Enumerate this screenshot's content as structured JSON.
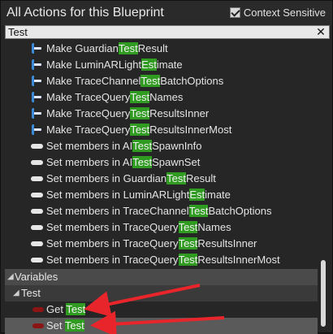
{
  "header": {
    "title": "All Actions for this Blueprint",
    "context_sensitive_label": "Context Sensitive",
    "context_sensitive_checked": true
  },
  "search": {
    "value": "Test",
    "clear_icon": "close-icon"
  },
  "items": [
    {
      "icon": "function-icon",
      "prefix": "Make Guardian",
      "match": "Test",
      "suffix": "Result"
    },
    {
      "icon": "function-icon",
      "prefix": "Make LuminARLight",
      "match": "Est",
      "suffix": "imate"
    },
    {
      "icon": "function-icon",
      "prefix": "Make TraceChannel",
      "match": "Test",
      "suffix": "BatchOptions"
    },
    {
      "icon": "function-icon",
      "prefix": "Make TraceQuery",
      "match": "Test",
      "suffix": "Names"
    },
    {
      "icon": "function-icon",
      "prefix": "Make TraceQuery",
      "match": "Test",
      "suffix": "ResultsInner"
    },
    {
      "icon": "function-icon",
      "prefix": "Make TraceQuery",
      "match": "Test",
      "suffix": "ResultsInnerMost"
    },
    {
      "icon": "set-members-icon",
      "prefix": "Set members in AI",
      "match": "Test",
      "suffix": "SpawnInfo"
    },
    {
      "icon": "set-members-icon",
      "prefix": "Set members in AI",
      "match": "Test",
      "suffix": "SpawnSet"
    },
    {
      "icon": "set-members-icon",
      "prefix": "Set members in Guardian",
      "match": "Test",
      "suffix": "Result"
    },
    {
      "icon": "set-members-icon",
      "prefix": "Set members in LuminARLight",
      "match": "Est",
      "suffix": "imate"
    },
    {
      "icon": "set-members-icon",
      "prefix": "Set members in TraceChannel",
      "match": "Test",
      "suffix": "BatchOptions"
    },
    {
      "icon": "set-members-icon",
      "prefix": "Set members in TraceQuery",
      "match": "Test",
      "suffix": "Names"
    },
    {
      "icon": "set-members-icon",
      "prefix": "Set members in TraceQuery",
      "match": "Test",
      "suffix": "ResultsInner"
    },
    {
      "icon": "set-members-icon",
      "prefix": "Set members in TraceQuery",
      "match": "Test",
      "suffix": "ResultsInnerMost"
    }
  ],
  "variables": {
    "category_label": "Variables",
    "subcategory_label": "Test",
    "items": [
      {
        "icon": "variable-icon",
        "prefix": "Get ",
        "match": "Test",
        "suffix": "",
        "selected": false
      },
      {
        "icon": "variable-icon",
        "prefix": "Set ",
        "match": "Test",
        "suffix": "",
        "selected": true
      }
    ]
  },
  "colors": {
    "highlight": "#2f9b20",
    "annotation_arrow": "#e8252b",
    "variable_pin": "#8b1414",
    "function_icon": "#3c8ad6"
  }
}
